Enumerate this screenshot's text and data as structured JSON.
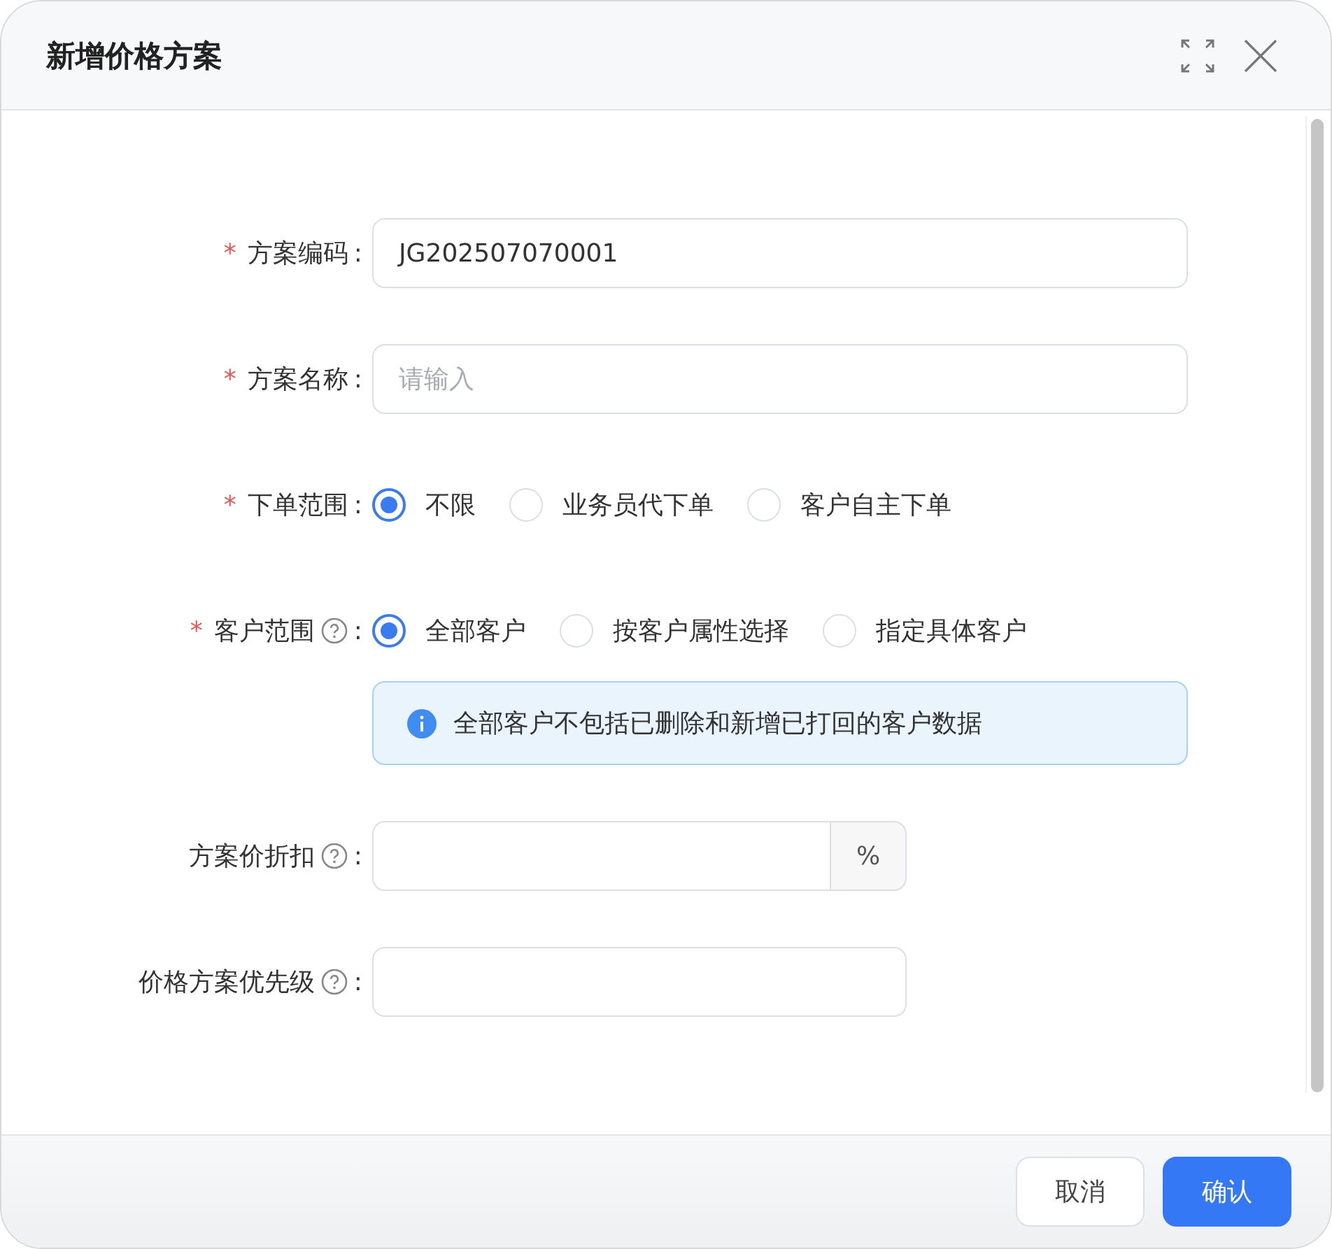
{
  "dialog": {
    "title": "新增价格方案"
  },
  "form": {
    "fields": [
      {
        "kind": "text",
        "required_mark": "*",
        "label": "方案编码",
        "help": false,
        "colon": ":",
        "value": "JG202507070001"
      },
      {
        "kind": "text",
        "required_mark": "*",
        "label": "方案名称",
        "help": false,
        "colon": ":",
        "placeholder": "请输入"
      },
      {
        "kind": "radio",
        "required_mark": "*",
        "label": "下单范围",
        "help": false,
        "colon": ":",
        "options": [
          {
            "label": "不限",
            "selected": true
          },
          {
            "label": "业务员代下单",
            "selected": false
          },
          {
            "label": "客户自主下单",
            "selected": false
          }
        ]
      },
      {
        "kind": "radio",
        "required_mark": "*",
        "label": "客户范围",
        "help": true,
        "colon": ":",
        "options": [
          {
            "label": "全部客户",
            "selected": true
          },
          {
            "label": "按客户属性选择",
            "selected": false
          },
          {
            "label": "指定具体客户",
            "selected": false
          }
        ],
        "notice": "全部客户不包括已删除和新增已打回的客户数据"
      },
      {
        "kind": "suffix",
        "label": "方案价折扣",
        "help": true,
        "colon": ":",
        "suffix": "%"
      },
      {
        "kind": "short",
        "label": "价格方案优先级",
        "help": true,
        "colon": ":"
      }
    ]
  },
  "footer": {
    "buttons": [
      {
        "label": "取消",
        "kind": "default"
      },
      {
        "label": "确认",
        "kind": "primary"
      }
    ]
  }
}
